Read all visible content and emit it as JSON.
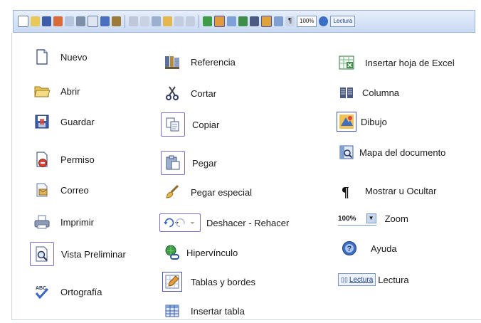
{
  "toolbar": {
    "zoom_label": "100%",
    "lectura_label": "Lectura"
  },
  "columns": {
    "left": [
      {
        "label": "Nuevo",
        "icon": "new-document-icon"
      },
      {
        "label": "Abrir",
        "icon": "open-folder-icon"
      },
      {
        "label": "Guardar",
        "icon": "save-disk-icon"
      },
      {
        "label": "Permiso",
        "icon": "permission-icon"
      },
      {
        "label": "Correo",
        "icon": "mail-icon"
      },
      {
        "label": "Imprimir",
        "icon": "printer-icon"
      },
      {
        "label": "Vista Preliminar",
        "icon": "print-preview-icon"
      },
      {
        "label": "Ortografía",
        "icon": "spelling-icon"
      }
    ],
    "middle": [
      {
        "label": "Referencia",
        "icon": "reference-icon"
      },
      {
        "label": "Cortar",
        "icon": "scissors-icon"
      },
      {
        "label": "Copiar",
        "icon": "copy-icon"
      },
      {
        "label": "Pegar",
        "icon": "paste-icon"
      },
      {
        "label": "Pegar especial",
        "icon": "brush-icon"
      },
      {
        "label": "Deshacer - Rehacer",
        "icon": "undo-redo-icon"
      },
      {
        "label": "Hipervínculo",
        "icon": "hyperlink-icon"
      },
      {
        "label": "Tablas y bordes",
        "icon": "tables-borders-icon"
      },
      {
        "label": "Insertar tabla",
        "icon": "insert-table-icon"
      }
    ],
    "right": [
      {
        "label": "Insertar hoja de Excel",
        "icon": "excel-sheet-icon"
      },
      {
        "label": "Columna",
        "icon": "columns-icon"
      },
      {
        "label": "Dibujo",
        "icon": "drawing-icon"
      },
      {
        "label": "Mapa del documento",
        "icon": "document-map-icon"
      },
      {
        "label": "Mostrar u Ocultar",
        "icon": "pilcrow-icon"
      },
      {
        "label": "Zoom",
        "icon": "zoom-box",
        "zoom_value": "100%"
      },
      {
        "label": "Ayuda",
        "icon": "help-icon"
      },
      {
        "label": "Lectura",
        "icon": "reading-button",
        "button_text": "Lectura"
      }
    ]
  }
}
